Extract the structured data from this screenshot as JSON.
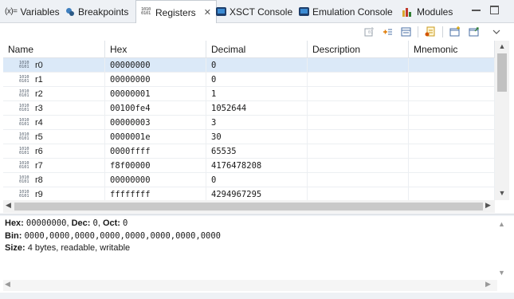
{
  "tabs": [
    {
      "label": "Variables",
      "icon": "variables-icon"
    },
    {
      "label": "Breakpoints",
      "icon": "breakpoints-icon"
    },
    {
      "label": "Registers",
      "icon": "registers-icon",
      "active": true
    },
    {
      "label": "XSCT Console",
      "icon": "console-icon"
    },
    {
      "label": "Emulation Console",
      "icon": "console-icon"
    },
    {
      "label": "Modules",
      "icon": "modules-icon"
    }
  ],
  "variables_prefix": "(x)=",
  "columns": [
    "Name",
    "Hex",
    "Decimal",
    "Description",
    "Mnemonic"
  ],
  "registers": [
    {
      "name": "r0",
      "hex": "00000000",
      "decimal": "0",
      "description": "",
      "mnemonic": ""
    },
    {
      "name": "r1",
      "hex": "00000000",
      "decimal": "0",
      "description": "",
      "mnemonic": ""
    },
    {
      "name": "r2",
      "hex": "00000001",
      "decimal": "1",
      "description": "",
      "mnemonic": ""
    },
    {
      "name": "r3",
      "hex": "00100fe4",
      "decimal": "1052644",
      "description": "",
      "mnemonic": ""
    },
    {
      "name": "r4",
      "hex": "00000003",
      "decimal": "3",
      "description": "",
      "mnemonic": ""
    },
    {
      "name": "r5",
      "hex": "0000001e",
      "decimal": "30",
      "description": "",
      "mnemonic": ""
    },
    {
      "name": "r6",
      "hex": "0000ffff",
      "decimal": "65535",
      "description": "",
      "mnemonic": ""
    },
    {
      "name": "r7",
      "hex": "f8f00000",
      "decimal": "4176478208",
      "description": "",
      "mnemonic": ""
    },
    {
      "name": "r8",
      "hex": "00000000",
      "decimal": "0",
      "description": "",
      "mnemonic": ""
    },
    {
      "name": "r9",
      "hex": "ffffffff",
      "decimal": "4294967295",
      "description": "",
      "mnemonic": ""
    }
  ],
  "selected_row": 0,
  "detail": {
    "hex_label": "Hex:",
    "hex_value": "00000000",
    "dec_label": "Dec:",
    "dec_value": "0",
    "oct_label": "Oct:",
    "oct_value": "0",
    "bin_label": "Bin:",
    "bin_value": "0000,0000,0000,0000,0000,0000,0000,0000",
    "size_label": "Size:",
    "size_value": "4 bytes, readable, writable"
  },
  "reg_icon_text": "1010 0101",
  "colors": {
    "selection": "#dbe9f8",
    "tabbar": "#eef1f5",
    "console_icon": "#1d3e6b"
  }
}
